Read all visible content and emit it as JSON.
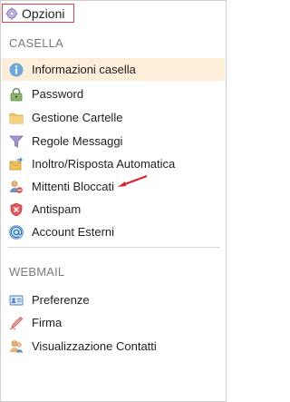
{
  "header": {
    "title": "Opzioni",
    "icon": "gear-icon"
  },
  "casella": {
    "section_title": "CASELLA",
    "items": [
      {
        "label": "Informazioni casella",
        "icon": "info-icon"
      },
      {
        "label": "Password",
        "icon": "lock-icon"
      },
      {
        "label": "Gestione Cartelle",
        "icon": "folder-icon"
      },
      {
        "label": "Regole Messaggi",
        "icon": "filter-icon"
      },
      {
        "label": "Inoltro/Risposta Automatica",
        "icon": "forward-mail-icon"
      },
      {
        "label": "Mittenti Bloccati",
        "icon": "blocked-user-icon"
      },
      {
        "label": "Antispam",
        "icon": "shield-icon"
      },
      {
        "label": "Account Esterni",
        "icon": "at-sign-icon"
      }
    ]
  },
  "webmail": {
    "section_title": "WEBMAIL",
    "items": [
      {
        "label": "Preferenze",
        "icon": "id-card-icon"
      },
      {
        "label": "Firma",
        "icon": "pen-icon"
      },
      {
        "label": "Visualizzazione Contatti",
        "icon": "contacts-icon"
      }
    ]
  },
  "colors": {
    "selected_bg": "#fdeed9",
    "highlight_border": "#d9434f",
    "annotation_arrow": "#e0202a"
  }
}
